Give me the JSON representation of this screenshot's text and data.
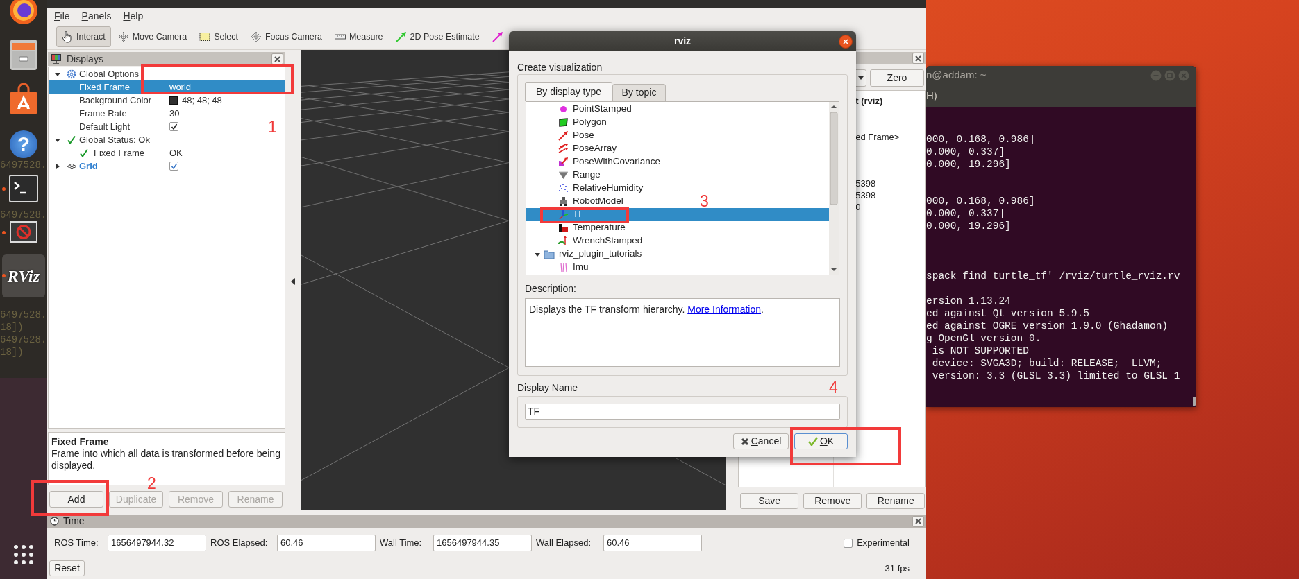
{
  "dock": {
    "backdrop_lines": [
      "6497528.",
      "6497528.",
      "6497528.",
      "18])",
      "6497528.",
      "18])"
    ],
    "items": [
      {
        "kind": "browser",
        "running": false,
        "selected": false
      },
      {
        "kind": "files",
        "running": false,
        "selected": false
      },
      {
        "kind": "store",
        "running": false,
        "selected": false
      },
      {
        "kind": "help",
        "glyph": "?",
        "running": false,
        "selected": false
      },
      {
        "kind": "terminal",
        "running": true,
        "selected": false
      },
      {
        "kind": "blocked",
        "running": true,
        "selected": false
      },
      {
        "kind": "rviz",
        "label": "RViz",
        "running": true,
        "selected": true
      },
      {
        "kind": "apps",
        "running": false,
        "selected": false
      }
    ]
  },
  "rviz": {
    "menu": [
      "File",
      "Panels",
      "Help"
    ],
    "toolbar": [
      {
        "kind": "interact",
        "label": "Interact",
        "selected": true
      },
      {
        "kind": "move",
        "label": "Move Camera",
        "selected": false
      },
      {
        "kind": "select",
        "label": "Select",
        "selected": false
      },
      {
        "kind": "focus",
        "label": "Focus Camera",
        "selected": false
      },
      {
        "kind": "measure",
        "label": "Measure",
        "selected": false
      },
      {
        "kind": "pose",
        "label": "2D Pose Estimate",
        "selected": false
      },
      {
        "kind": "goal",
        "selected": false
      }
    ],
    "displays": {
      "title": "Displays",
      "tree": [
        {
          "name": "Global Options",
          "kind": "options",
          "expanded": true,
          "selected": false,
          "children": [
            {
              "name": "Fixed Frame",
              "kind": "property",
              "value": "world",
              "selected": true
            },
            {
              "name": "Background Color",
              "kind": "property",
              "value": "48; 48; 48",
              "color": "#303030",
              "selected": false
            },
            {
              "name": "Frame Rate",
              "kind": "property",
              "value": "30",
              "selected": false
            },
            {
              "name": "Default Light",
              "kind": "property",
              "checked": true,
              "selected": false
            }
          ]
        },
        {
          "name": "Global Status: Ok",
          "kind": "status",
          "expanded": true,
          "selected": false,
          "children": [
            {
              "name": "Fixed Frame",
              "kind": "status",
              "value": "OK",
              "selected": false
            }
          ]
        },
        {
          "name": "Grid",
          "kind": "display",
          "expanded": false,
          "checked": true,
          "selected": false
        }
      ],
      "description": {
        "title": "Fixed Frame",
        "text": "Frame into which all data is transformed before being displayed."
      },
      "buttons": [
        {
          "label": "Add",
          "disabled": false
        },
        {
          "label": "Duplicate",
          "disabled": true
        },
        {
          "label": "Remove",
          "disabled": true
        },
        {
          "label": "Rename",
          "disabled": true
        }
      ]
    },
    "views": {
      "button": "Zero",
      "texts": [
        "t (rviz)",
        "ed Frame>",
        "5398",
        "5398",
        "0"
      ],
      "buttons": [
        "Save",
        "Remove",
        "Rename"
      ]
    },
    "time": {
      "title": "Time",
      "fields": [
        {
          "label": "ROS Time:",
          "value": "1656497944.32"
        },
        {
          "label": "ROS Elapsed:",
          "value": "60.46"
        },
        {
          "label": "Wall Time:",
          "value": "1656497944.35"
        },
        {
          "label": "Wall Elapsed:",
          "value": "60.46"
        }
      ],
      "experimental": {
        "label": "Experimental",
        "checked": false
      },
      "reset": "Reset",
      "fps": "31 fps"
    }
  },
  "dialog": {
    "title": "rviz",
    "heading": "Create visualization",
    "tabs": [
      {
        "label": "By display type",
        "selected": true
      },
      {
        "label": "By topic",
        "selected": false
      }
    ],
    "list": [
      {
        "name": "PointStamped",
        "kind": "point",
        "selected": false
      },
      {
        "name": "Polygon",
        "kind": "polygon",
        "selected": false
      },
      {
        "name": "Pose",
        "kind": "pose",
        "selected": false
      },
      {
        "name": "PoseArray",
        "kind": "posearray",
        "selected": false
      },
      {
        "name": "PoseWithCovariance",
        "kind": "posecov",
        "selected": false
      },
      {
        "name": "Range",
        "kind": "range",
        "selected": false
      },
      {
        "name": "RelativeHumidity",
        "kind": "humidity",
        "selected": false
      },
      {
        "name": "RobotModel",
        "kind": "robot",
        "selected": false
      },
      {
        "name": "TF",
        "kind": "tf",
        "selected": true
      },
      {
        "name": "Temperature",
        "kind": "temperature",
        "selected": false
      },
      {
        "name": "WrenchStamped",
        "kind": "wrench",
        "selected": false
      },
      {
        "name": "rviz_plugin_tutorials",
        "kind": "folder",
        "expanded": true,
        "selected": false,
        "children": [
          {
            "name": "Imu",
            "kind": "imu",
            "selected": false
          }
        ]
      }
    ],
    "description_label": "Description:",
    "description": "Displays the TF transform hierarchy.",
    "link": "More Information",
    "after_link": ".",
    "display_name_label": "Display Name",
    "display_name": "TF",
    "buttons": [
      {
        "kind": "cancel",
        "label": "Cancel"
      },
      {
        "kind": "ok",
        "label": "OK"
      }
    ]
  },
  "terminal": {
    "title": "n@addam: ~",
    "menu": "H)",
    "blocks": [
      [
        "000, 0.168, 0.986]",
        "0.000, 0.337]",
        "0.000, 19.296]"
      ],
      [
        "000, 0.168, 0.986]",
        "0.000, 0.337]",
        "0.000, 19.296]"
      ],
      [
        "spack find turtle_tf' /rviz/turtle_rviz.rv"
      ],
      [
        "ersion 1.13.24",
        "ed against Qt version 5.9.5",
        "ed against OGRE version 1.9.0 (Ghadamon)",
        "g OpenGl version 0.",
        " is NOT SUPPORTED",
        " device: SVGA3D; build: RELEASE;  LLVM;",
        " version: 3.3 (GLSL 3.3) limited to GLSL 1"
      ]
    ]
  },
  "annotations": [
    {
      "label": "1"
    },
    {
      "label": "2"
    },
    {
      "label": "3"
    },
    {
      "label": "4"
    }
  ]
}
